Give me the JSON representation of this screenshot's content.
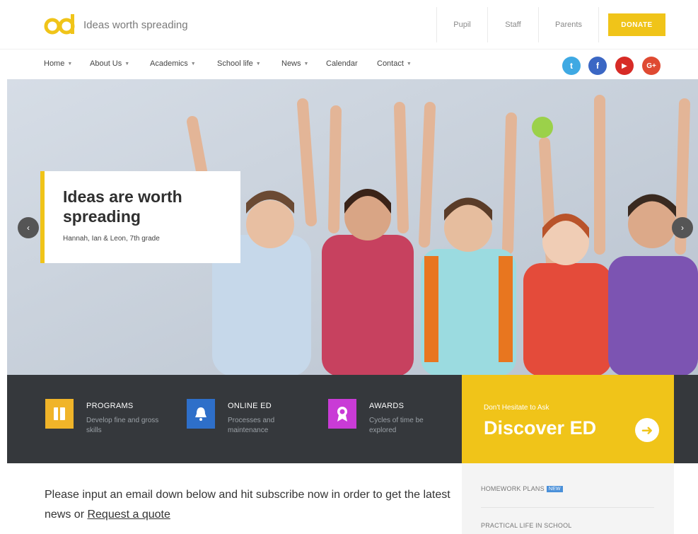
{
  "header": {
    "tagline": "Ideas worth spreading",
    "audience_links": [
      "Pupil",
      "Staff",
      "Parents"
    ],
    "donate_label": "DONATE"
  },
  "nav": {
    "items": [
      {
        "label": "Home",
        "dropdown": true
      },
      {
        "label": "About Us",
        "dropdown": true
      },
      {
        "label": "Academics",
        "dropdown": true
      },
      {
        "label": "School life",
        "dropdown": true
      },
      {
        "label": "News",
        "dropdown": true
      },
      {
        "label": "Calendar",
        "dropdown": false
      },
      {
        "label": "Contact",
        "dropdown": true
      }
    ],
    "social": [
      {
        "icon": "twitter-icon",
        "glyph": "t",
        "color": "#3fa9e3"
      },
      {
        "icon": "facebook-icon",
        "glyph": "f",
        "color": "#3b67c4"
      },
      {
        "icon": "youtube-icon",
        "glyph": "▶",
        "color": "#d72b26"
      },
      {
        "icon": "google-plus-icon",
        "glyph": "G+",
        "color": "#df4a32"
      }
    ]
  },
  "hero": {
    "title": "Ideas are worth spreading",
    "subtitle": "Hannah, Ian & Leon, 7th grade",
    "prev_icon": "‹",
    "next_icon": "›"
  },
  "features": [
    {
      "title": "PROGRAMS",
      "desc": "Develop fine and gross skills",
      "icon": "book-icon",
      "color": "#f0b429"
    },
    {
      "title": "ONLINE ED",
      "desc": "Processes and maintenance",
      "icon": "bell-icon",
      "color": "#2e6fc9"
    },
    {
      "title": "AWARDS",
      "desc": "Cycles of time be explored",
      "icon": "award-icon",
      "color": "#c93bd6"
    }
  ],
  "cta": {
    "kicker": "Don't Hesitate to Ask",
    "title": "Discover ED",
    "arrow": "➜"
  },
  "subscribe": {
    "text": "Please input an email down below and hit subscribe now in order to get the latest news or ",
    "link": "Request a quote"
  },
  "sidebar": {
    "items": [
      {
        "label": "HOMEWORK PLANS",
        "badge": "NEW"
      },
      {
        "label": "PRACTICAL LIFE IN SCHOOL",
        "badge": ""
      }
    ]
  },
  "colors": {
    "accent": "#f0c419",
    "dark_band": "#35383c"
  }
}
